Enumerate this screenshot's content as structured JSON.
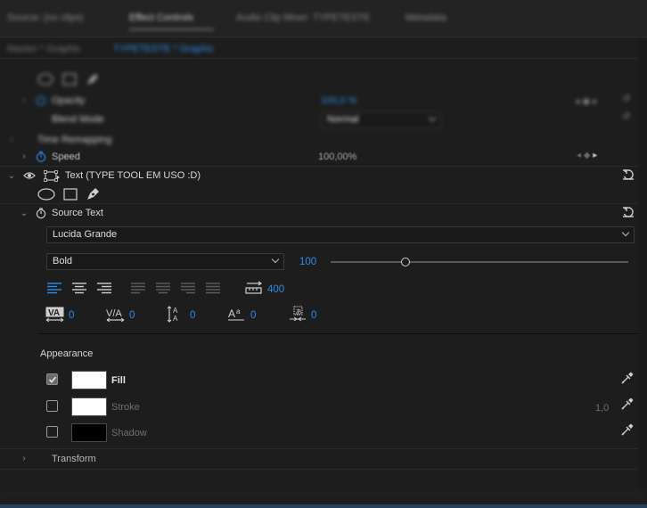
{
  "tabs": [
    "Source: (no clips)",
    "Effect Controls",
    "Audio Clip Mixer: TYPETESTE",
    "Metadata"
  ],
  "sequence_tabs": [
    "Master * Graphic",
    "TYPETESTE * Graphic"
  ],
  "opacity": {
    "label": "Opacity",
    "value": "100,0 %",
    "blend_label": "Blend Mode",
    "blend_value": "Normal"
  },
  "time_remapping": {
    "label": "Time Remapping",
    "speed_label": "Speed",
    "speed_value": "100,00%"
  },
  "text_layer": {
    "label": "Text (TYPE TOOL EM USO :D)"
  },
  "source_text": {
    "label": "Source Text",
    "font_family": "Lucida Grande",
    "font_style": "Bold",
    "font_size": "100",
    "font_size_level": 0.25,
    "tracking_field_value": "400",
    "kerning": "0",
    "tracking": "0",
    "leading": "0",
    "baseline_shift": "0",
    "tsume": "0"
  },
  "appearance": {
    "heading": "Appearance",
    "fill_label": "Fill",
    "fill_checked": true,
    "fill_color": "#ffffff",
    "stroke_label": "Stroke",
    "stroke_checked": false,
    "stroke_color": "#ffffff",
    "stroke_width": "1,0",
    "shadow_label": "Shadow",
    "shadow_checked": false,
    "shadow_color": "#000000"
  },
  "transform": {
    "label": "Transform"
  },
  "colors": {
    "accent_blue": "#2d8ceb",
    "panel_bg": "#1d1d1d"
  }
}
